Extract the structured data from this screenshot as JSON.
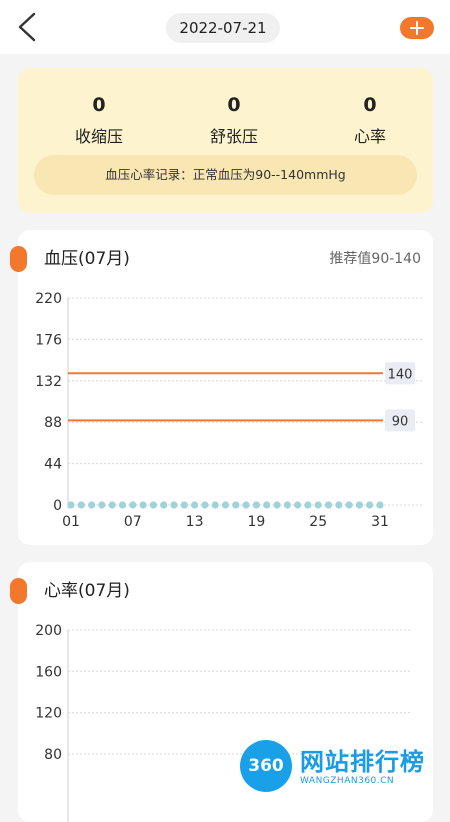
{
  "header": {
    "date": "2022-07-21"
  },
  "summary": {
    "stats": [
      {
        "value": "0",
        "label": "收缩压"
      },
      {
        "value": "0",
        "label": "舒张压"
      },
      {
        "value": "0",
        "label": "心率"
      }
    ],
    "note": "血压心率记录：正常血压为90--140mmHg"
  },
  "bp_card": {
    "title": "血压(07月)",
    "recommend": "推荐值90-140"
  },
  "hr_card": {
    "title": "心率(07月)"
  },
  "watermark": {
    "badge": "360",
    "name": "网站排行榜",
    "url": "WANGZHAN360.CN"
  },
  "colors": {
    "accent": "#f2782d",
    "summary_bg": "#fdf3cf",
    "dot": "#9fd3da"
  },
  "chart_data": [
    {
      "type": "line",
      "title": "血压(07月)",
      "xlabel": "",
      "ylabel": "",
      "ylim": [
        0,
        220
      ],
      "yticks": [
        "220",
        "176",
        "132",
        "88",
        "44",
        "0"
      ],
      "xticks": [
        "01",
        "07",
        "13",
        "19",
        "25",
        "31"
      ],
      "x": [
        1,
        2,
        3,
        4,
        5,
        6,
        7,
        8,
        9,
        10,
        11,
        12,
        13,
        14,
        15,
        16,
        17,
        18,
        19,
        20,
        21,
        22,
        23,
        24,
        25,
        26,
        27,
        28,
        29,
        30,
        31
      ],
      "series": [
        {
          "values": [
            0,
            0,
            0,
            0,
            0,
            0,
            0,
            0,
            0,
            0,
            0,
            0,
            0,
            0,
            0,
            0,
            0,
            0,
            0,
            0,
            0,
            0,
            0,
            0,
            0,
            0,
            0,
            0,
            0,
            0,
            0
          ]
        }
      ],
      "reference_lines": [
        {
          "value": 140,
          "label": "140"
        },
        {
          "value": 90,
          "label": "90"
        }
      ],
      "grid": true
    },
    {
      "type": "line",
      "title": "心率(07月)",
      "xlabel": "",
      "ylabel": "",
      "yticks": [
        "200",
        "160",
        "120",
        "80"
      ],
      "grid": true
    }
  ]
}
